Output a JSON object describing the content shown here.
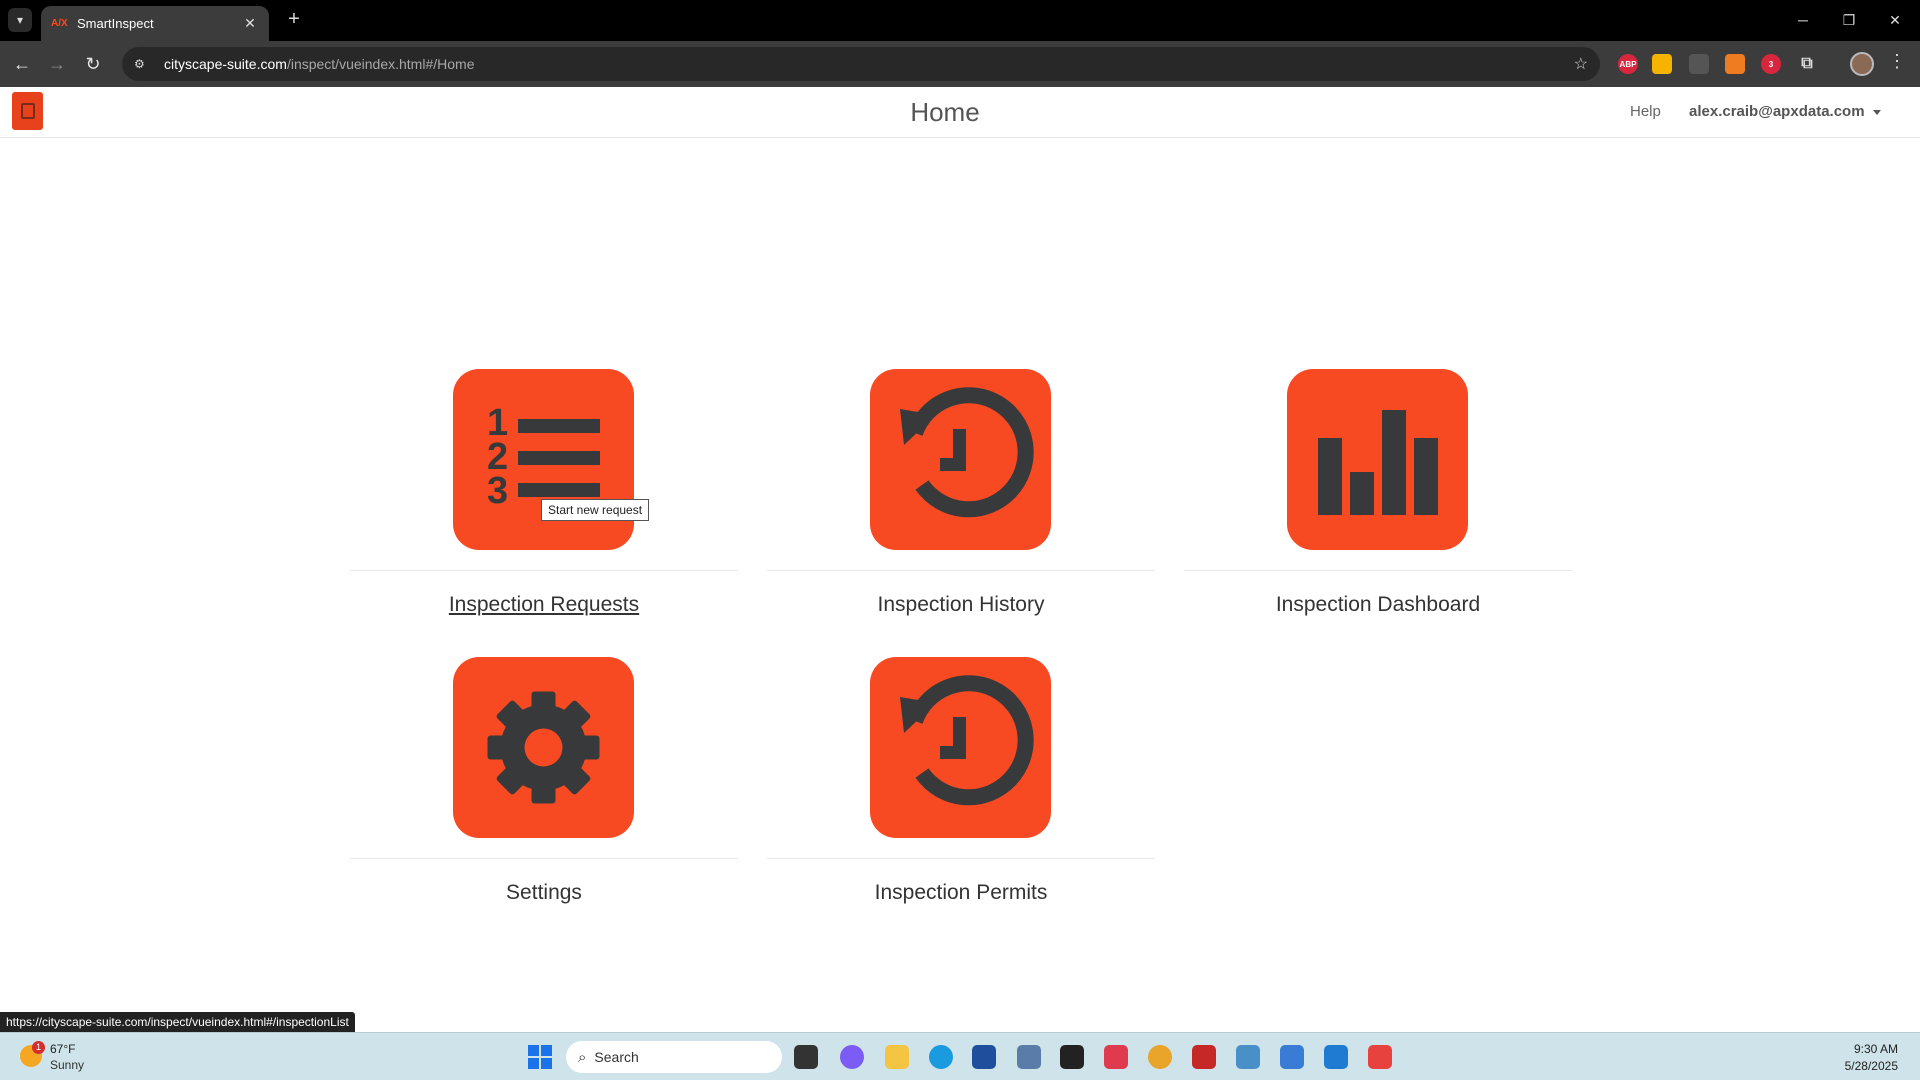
{
  "browser": {
    "tab_title": "SmartInspect",
    "tab_favicon_text": "A/X",
    "url_host": "cityscape-suite.com",
    "url_path": "/inspect/vueindex.html#/Home",
    "extension_badge": "3"
  },
  "header": {
    "title": "Home",
    "help_label": "Help",
    "user_email": "alex.craib@apxdata.com"
  },
  "tiles": [
    {
      "label": "Inspection Requests",
      "icon": "numbered-list-icon"
    },
    {
      "label": "Inspection History",
      "icon": "history-icon"
    },
    {
      "label": "Inspection Dashboard",
      "icon": "bar-chart-icon"
    },
    {
      "label": "Settings",
      "icon": "gear-icon"
    },
    {
      "label": "Inspection Permits",
      "icon": "history-icon"
    }
  ],
  "tooltip": "Start new request",
  "status_url": "https://cityscape-suite.com/inspect/vueindex.html#/inspectionList",
  "taskbar": {
    "weather_temp": "67°F",
    "weather_condition": "Sunny",
    "weather_badge": "1",
    "search_label": "Search",
    "time": "9:30 AM",
    "date": "5/28/2025"
  },
  "colors": {
    "tile_accent": "#f84a22",
    "icon_fill": "#37393b"
  }
}
